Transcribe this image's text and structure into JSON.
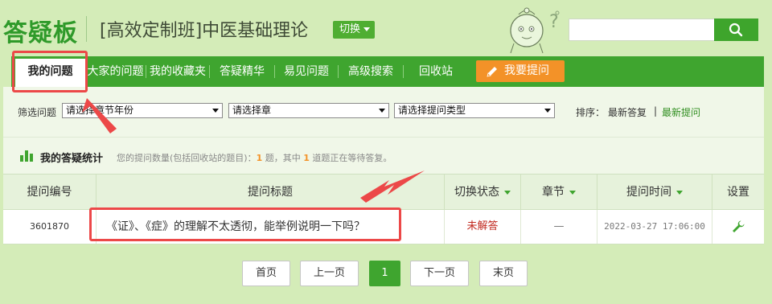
{
  "header": {
    "brand": "答疑板",
    "course_title": "[高效定制班]中医基础理论",
    "switch_label": "切换",
    "search_placeholder": "",
    "search_value": ""
  },
  "nav": {
    "items": [
      {
        "label": "我的问题",
        "active": true
      },
      {
        "label": "大家的问题"
      },
      {
        "label": "我的收藏夹"
      },
      {
        "label": "答疑精华"
      },
      {
        "label": "易见问题"
      },
      {
        "label": "高级搜索"
      },
      {
        "label": "回收站"
      }
    ],
    "ask_label": "我要提问"
  },
  "filters": {
    "label": "筛选问题",
    "selects": [
      {
        "value": "请选择章节年份"
      },
      {
        "value": "请选择章"
      },
      {
        "value": "请选择提问类型"
      }
    ],
    "sort_label": "排序：",
    "sort_latest_reply": "最新答复",
    "sort_sep": "|",
    "sort_latest_question": "最新提问"
  },
  "stats": {
    "title": "我的答疑统计",
    "text_prefix": "您的提问数量(包括回收站的题目)：",
    "count": "1",
    "text_mid": "题，其中",
    "pending": "1",
    "text_suffix": "道题正在等待答复。"
  },
  "table": {
    "headers": [
      "提问编号",
      "提问标题",
      "切换状态",
      "章节",
      "提问时间",
      "设置"
    ],
    "rows": [
      {
        "id": "3601870",
        "title": "《证》、《症》的理解不太透彻，能举例说明一下吗？",
        "status": "未解答",
        "chapter": "—",
        "time": "2022-03-27 17:06:00"
      }
    ]
  },
  "pagination": {
    "first": "首页",
    "prev": "上一页",
    "current": "1",
    "next": "下一页",
    "last": "末页"
  },
  "colors": {
    "brand_green": "#2f9a2a",
    "nav_green": "#3fa52f",
    "ask_orange": "#f39228",
    "status_red": "#c0281e",
    "annotation_red": "#ec4848"
  }
}
